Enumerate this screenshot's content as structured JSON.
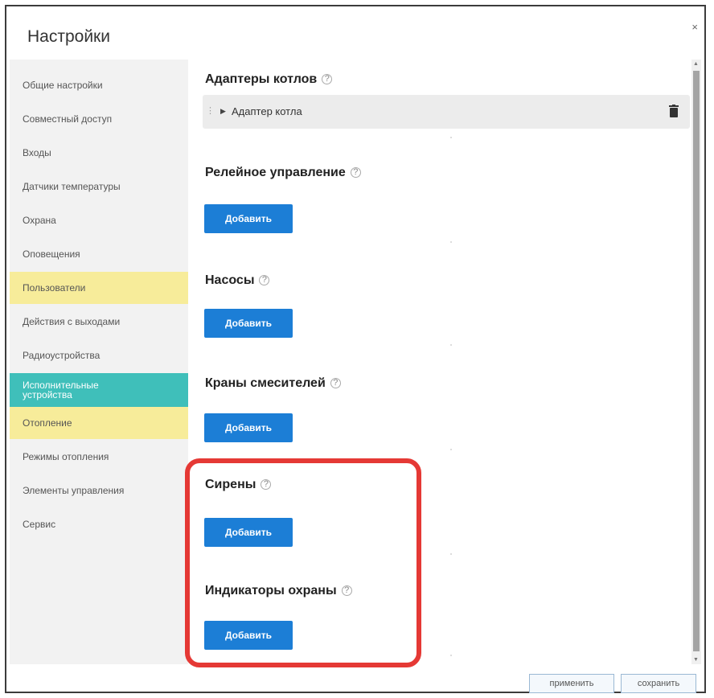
{
  "dialog": {
    "title": "Настройки",
    "close_glyph": "×"
  },
  "sidebar": {
    "items": [
      {
        "label": "Общие настройки",
        "state": "normal"
      },
      {
        "label": "Совместный доступ",
        "state": "normal"
      },
      {
        "label": "Входы",
        "state": "normal"
      },
      {
        "label": "Датчики температуры",
        "state": "normal"
      },
      {
        "label": "Охрана",
        "state": "normal"
      },
      {
        "label": "Оповещения",
        "state": "normal"
      },
      {
        "label": "Пользователи",
        "state": "highlighted"
      },
      {
        "label": "Действия с выходами",
        "state": "normal"
      },
      {
        "label": "Радиоустройства",
        "state": "normal"
      },
      {
        "label": "Исполнительные устройства",
        "state": "active"
      },
      {
        "label": "Отопление",
        "state": "highlighted"
      },
      {
        "label": "Режимы отопления",
        "state": "normal"
      },
      {
        "label": "Элементы управления",
        "state": "normal"
      },
      {
        "label": "Сервис",
        "state": "normal"
      }
    ]
  },
  "sections": {
    "adapters": {
      "title": "Адаптеры котлов",
      "item_label": "Адаптер котла"
    },
    "relay": {
      "title": "Релейное управление",
      "button": "Добавить"
    },
    "pumps": {
      "title": "Насосы",
      "button": "Добавить"
    },
    "mixers": {
      "title": "Краны смесителей",
      "button": "Добавить"
    },
    "sirens": {
      "title": "Сирены",
      "button": "Добавить"
    },
    "indicators": {
      "title": "Индикаторы охраны",
      "button": "Добавить"
    }
  },
  "help_glyph": "?",
  "footer": {
    "apply_label": "применить",
    "save_label": "сохранить"
  },
  "colors": {
    "active_tab": "#3fbfba",
    "highlight": "#f7ec9a",
    "button": "#1c7ed6",
    "annotation": "#e53935"
  }
}
